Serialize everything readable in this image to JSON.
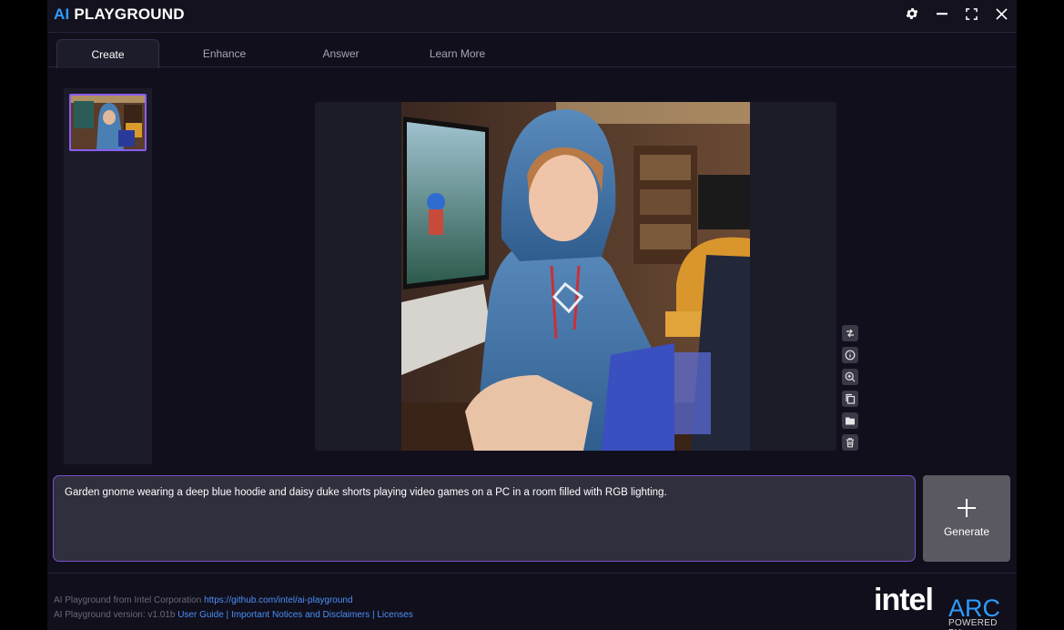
{
  "app": {
    "logo_ai": "AI",
    "logo_playground": "PLAYGROUND"
  },
  "window_controls": {
    "icons": [
      "gear-icon",
      "minimize-icon",
      "maximize-icon",
      "close-icon"
    ]
  },
  "tabs": [
    {
      "label": "Create",
      "active": true
    },
    {
      "label": "Enhance",
      "active": false
    },
    {
      "label": "Answer",
      "active": false
    },
    {
      "label": "Learn More",
      "active": false
    }
  ],
  "history": {
    "thumbnail_count": 1,
    "selected_index": 0
  },
  "image_tools": [
    "compare-icon",
    "info-icon",
    "zoom-in-icon",
    "copy-icon",
    "folder-icon",
    "trash-icon"
  ],
  "prompt": {
    "text": "Garden gnome wearing a deep blue hoodie and daisy duke shorts playing video games on a PC in a room filled with RGB lighting."
  },
  "generate": {
    "label": "Generate"
  },
  "footer": {
    "line1_text": "AI Playground from Intel Corporation ",
    "line1_link": "https://github.com/intel/ai-playground",
    "line2_text": "AI Playground version: v1.01b ",
    "line2_links": [
      "User Guide",
      "Important Notices and Disclaimers",
      "Licenses"
    ],
    "separator": " | "
  },
  "brand": {
    "intel": "intel",
    "arc": "ARC",
    "powered_by": "POWERED BY"
  },
  "colors": {
    "accent_blue": "#2f9bff",
    "prompt_border": "#7b4fc8",
    "thumb_border": "#8b5cf6",
    "background": "#100f1b"
  }
}
